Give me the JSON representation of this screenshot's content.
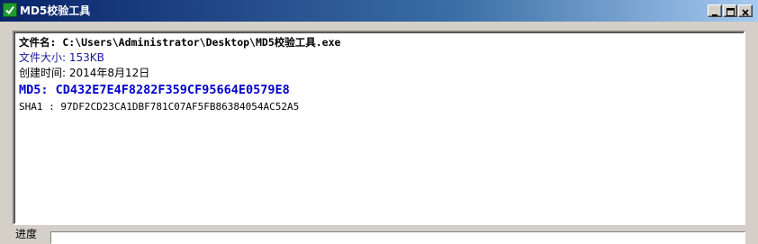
{
  "window": {
    "title": "MD5校验工具",
    "icon": "checkmark-icon",
    "controls": {
      "minimize_icon": "minimize-icon",
      "maximize_icon": "maximize-icon",
      "close_icon": "close-icon"
    }
  },
  "output": {
    "filename_line": "文件名: C:\\Users\\Administrator\\Desktop\\MD5校验工具.exe",
    "size_line": "文件大小: 153KB",
    "created_line": "创建时间: 2014年8月12日",
    "md5_line": "MD5: CD432E7E4F8282F359CF95664E0579E8",
    "sha1_line": "SHA1  : 97DF2CD23CA1DBF781C07AF5FB86384054AC52A5"
  },
  "progress": {
    "label": "进度",
    "value": 0
  },
  "colors": {
    "title_start": "#0a246a",
    "title_end": "#a6caf0",
    "md5_text": "#0000cc",
    "size_text": "#1a1a9c"
  }
}
